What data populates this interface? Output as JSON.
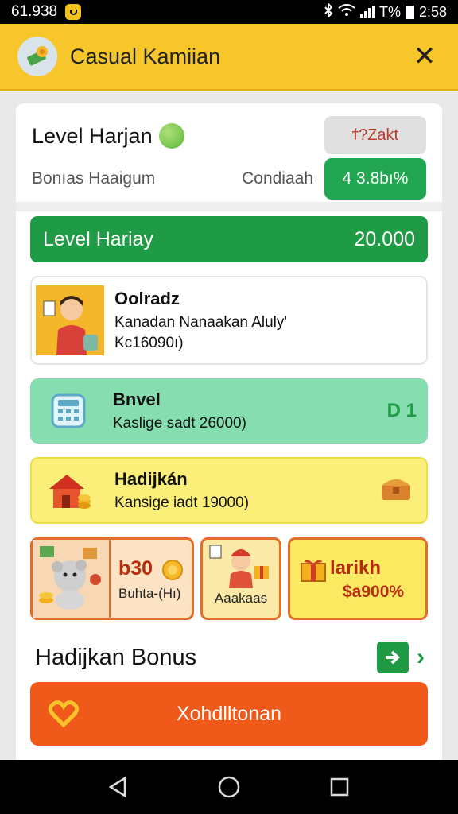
{
  "status_bar": {
    "time": "61.938",
    "right_text": "T%",
    "clock": "2:58"
  },
  "header": {
    "title": "Casual Kamiian",
    "close_label": "✕"
  },
  "summary": {
    "level_title": "Level Harjan",
    "pill_top": "ϯ?Zakt",
    "bonus_label": "Bonıas Haaigum",
    "condition_label": "Condiaah",
    "pill_value": "4 3.8bı%"
  },
  "level_bar": {
    "label": "Level Hariay",
    "value": "20.000"
  },
  "items": [
    {
      "title": "Oolradz",
      "line1": "Kanadan Nanaakan Aluly'",
      "line2": "Kc16090ı)"
    },
    {
      "title": "Bnvel",
      "line1": "Kaslige sadt 26000)",
      "badge": "D 1"
    },
    {
      "title": "Hadijkán",
      "line1": "Kansige iadt 19000)"
    }
  ],
  "tiles": [
    {
      "value": "b30",
      "label": "Buhta-(Hı)"
    },
    {
      "label": "Aaakaas"
    },
    {
      "label": "larikh",
      "value": "$a900%"
    }
  ],
  "section": {
    "title": "Hadijkan Bonus",
    "chevron": "›"
  },
  "cta": {
    "label": "Xohdlltonan"
  },
  "colors": {
    "brand_yellow": "#f6c62a",
    "green": "#1f9a45",
    "orange": "#ef5a1a"
  }
}
